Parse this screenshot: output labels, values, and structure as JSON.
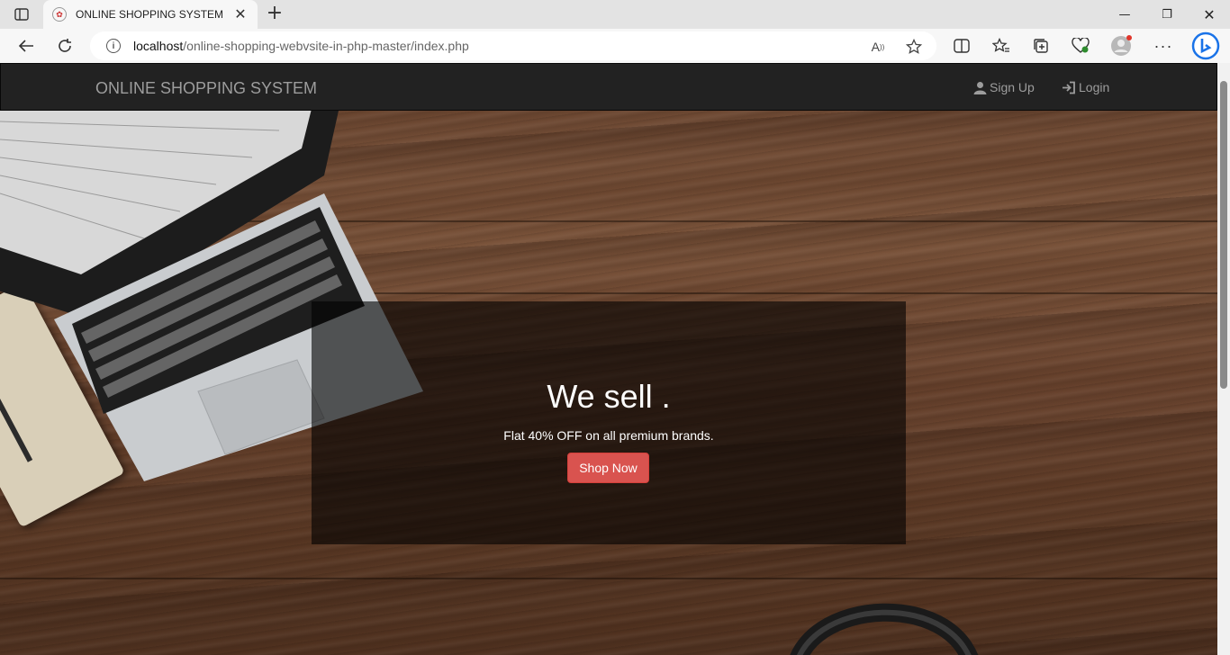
{
  "browser": {
    "tab": {
      "title": "ONLINE SHOPPING SYSTEM",
      "close": "✕"
    },
    "new_tab": "+",
    "caption": {
      "minimize": "—",
      "restore": "❐",
      "close": "✕"
    },
    "url": {
      "host": "localhost",
      "path": "/online-shopping-webvsite-in-php-master/index.php"
    },
    "icons": [
      "tab-actions-icon",
      "back-icon",
      "refresh-icon",
      "site-info-icon",
      "read-aloud-icon",
      "favorite-star-icon",
      "split-screen-icon",
      "favorites-icon",
      "collections-icon",
      "browser-essentials-icon",
      "profile-icon",
      "more-icon",
      "bing-icon"
    ],
    "colors": {
      "tabbar": "#e3e3e3",
      "toolbar": "#f7f7f7",
      "accent": "#0078d4"
    }
  },
  "navbar": {
    "brand": "ONLINE SHOPPING SYSTEM",
    "signup": "Sign Up",
    "login": "Login"
  },
  "hero": {
    "title": "We sell .",
    "subtitle": "Flat 40% OFF on all premium brands.",
    "button": "Shop Now"
  },
  "colors": {
    "navbar": "#222222",
    "nav_text": "#9d9d9d",
    "button": "#d9534f",
    "wood": "#6a4631"
  }
}
